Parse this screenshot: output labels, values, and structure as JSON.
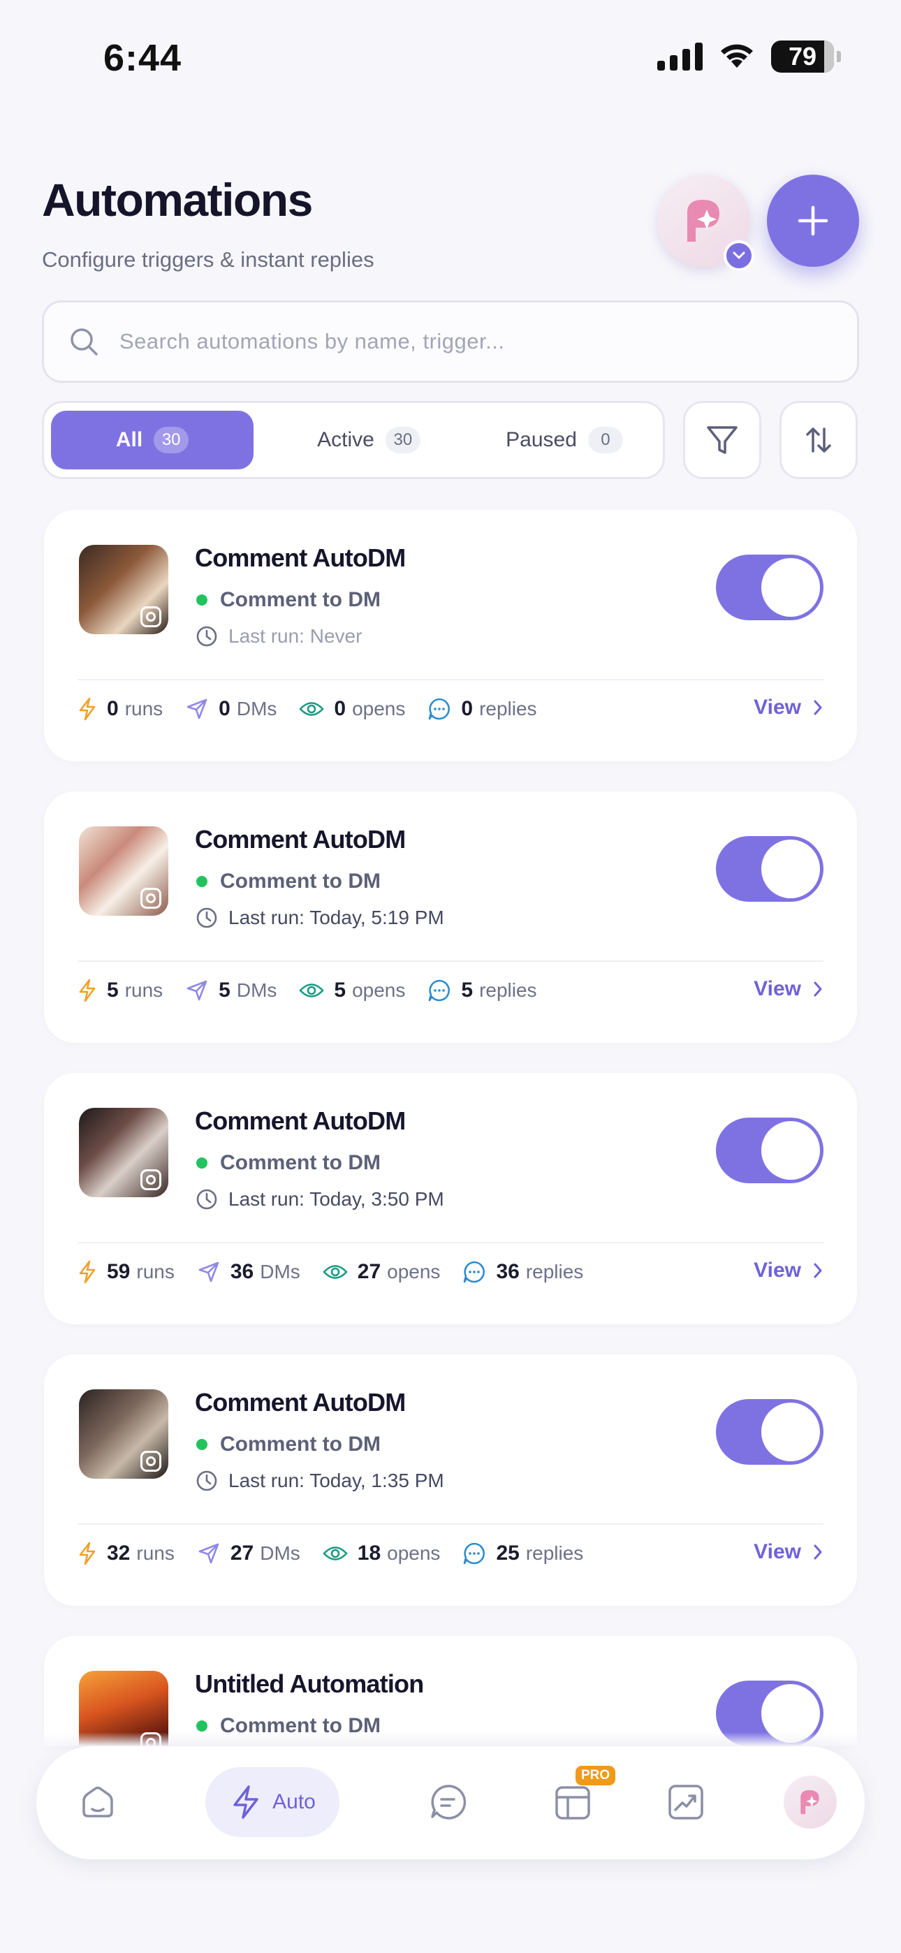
{
  "status_bar": {
    "time": "6:44",
    "battery": "79"
  },
  "header": {
    "title": "Automations",
    "subtitle": "Configure triggers & instant replies"
  },
  "search": {
    "placeholder": "Search automations by name, trigger..."
  },
  "filters": {
    "tabs": [
      {
        "label": "All",
        "count": "30",
        "selected": true
      },
      {
        "label": "Active",
        "count": "30",
        "selected": false
      },
      {
        "label": "Paused",
        "count": "0",
        "selected": false
      }
    ]
  },
  "colors": {
    "accent": "#7e72e3",
    "active_dot": "#22c35e",
    "pro_badge": "#f09a17"
  },
  "automations": [
    {
      "title": "Comment AutoDM",
      "trigger": "Comment to DM",
      "last_run": "Last run: Never",
      "enabled": true,
      "runs": "0",
      "runs_label": "runs",
      "dms": "0",
      "dms_label": "DMs",
      "opens": "0",
      "opens_label": "opens",
      "replies": "0",
      "replies_label": "replies",
      "view_label": "View"
    },
    {
      "title": "Comment AutoDM",
      "trigger": "Comment to DM",
      "last_run": "Last run: Today, 5:19 PM",
      "enabled": true,
      "runs": "5",
      "runs_label": "runs",
      "dms": "5",
      "dms_label": "DMs",
      "opens": "5",
      "opens_label": "opens",
      "replies": "5",
      "replies_label": "replies",
      "view_label": "View"
    },
    {
      "title": "Comment AutoDM",
      "trigger": "Comment to DM",
      "last_run": "Last run: Today, 3:50 PM",
      "enabled": true,
      "runs": "59",
      "runs_label": "runs",
      "dms": "36",
      "dms_label": "DMs",
      "opens": "27",
      "opens_label": "opens",
      "replies": "36",
      "replies_label": "replies",
      "view_label": "View"
    },
    {
      "title": "Comment AutoDM",
      "trigger": "Comment to DM",
      "last_run": "Last run: Today, 1:35 PM",
      "enabled": true,
      "runs": "32",
      "runs_label": "runs",
      "dms": "27",
      "dms_label": "DMs",
      "opens": "18",
      "opens_label": "opens",
      "replies": "25",
      "replies_label": "replies",
      "view_label": "View"
    },
    {
      "title": "Untitled Automation",
      "trigger": "Comment to DM",
      "enabled": true
    }
  ],
  "bottom_nav": {
    "items": [
      {
        "id": "home",
        "icon": "home-icon"
      },
      {
        "id": "auto",
        "icon": "bolt-icon",
        "label": "Auto",
        "selected": true
      },
      {
        "id": "messages",
        "icon": "chat-icon"
      },
      {
        "id": "templates",
        "icon": "layout-icon",
        "badge": "PRO"
      },
      {
        "id": "analytics",
        "icon": "chart-icon"
      },
      {
        "id": "profile",
        "icon": "avatar"
      }
    ]
  }
}
